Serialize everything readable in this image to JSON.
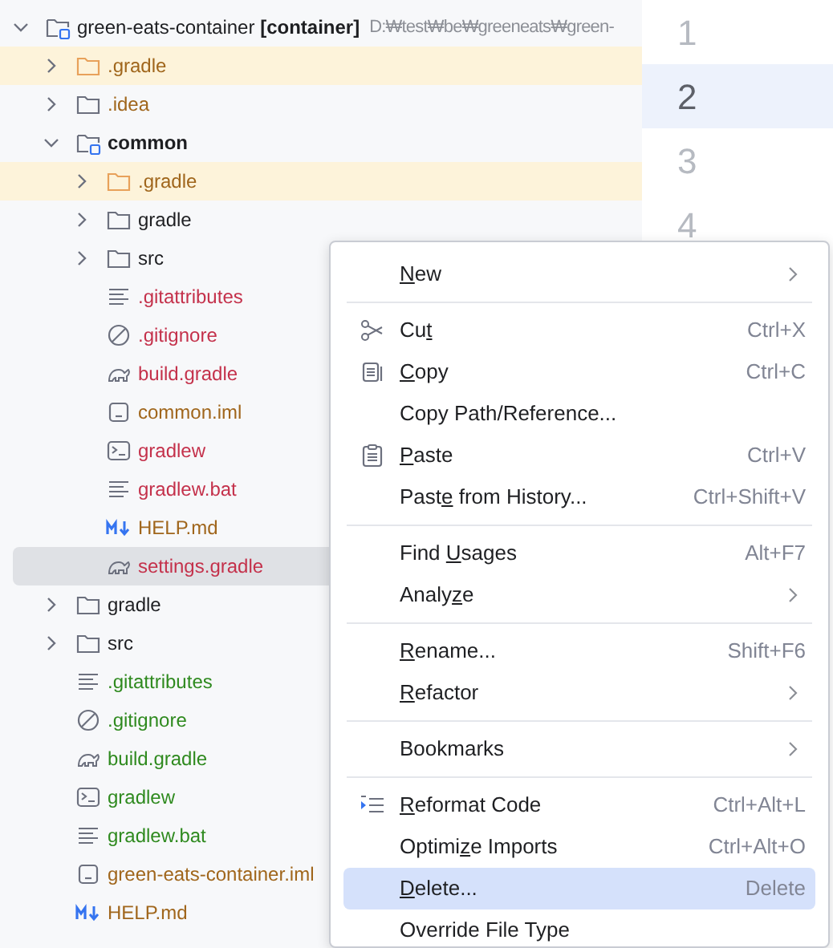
{
  "project_tree": [
    {
      "label": "green-eats-container **[container]**",
      "path": "D:₩test₩be₩greeneats₩green-",
      "kind": "module",
      "expanded": true,
      "bold": false,
      "color": "#1e1f22",
      "highlighted": false,
      "selected": false,
      "children": [
        {
          "label": ".gradle",
          "kind": "folder",
          "expanded": false,
          "bold": false,
          "color": "#a0661c",
          "highlighted": true,
          "selected": false
        },
        {
          "label": ".idea",
          "kind": "folder",
          "expanded": false,
          "bold": false,
          "color": "#a0661c",
          "highlighted": false,
          "selected": false
        },
        {
          "label": "common",
          "kind": "module",
          "expanded": true,
          "bold": true,
          "color": "#1e1f22",
          "highlighted": false,
          "selected": false,
          "children": [
            {
              "label": ".gradle",
              "kind": "folder",
              "expanded": false,
              "bold": false,
              "color": "#a0661c",
              "highlighted": true,
              "selected": false
            },
            {
              "label": "gradle",
              "kind": "folder",
              "expanded": false,
              "bold": false,
              "color": "#1e1f22",
              "highlighted": false,
              "selected": false
            },
            {
              "label": "src",
              "kind": "folder",
              "expanded": false,
              "bold": false,
              "color": "#1e1f22",
              "highlighted": false,
              "selected": false
            },
            {
              "label": ".gitattributes",
              "kind": "text",
              "bold": false,
              "color": "#c4314b",
              "highlighted": false,
              "selected": false
            },
            {
              "label": ".gitignore",
              "kind": "ignore",
              "bold": false,
              "color": "#c4314b",
              "highlighted": false,
              "selected": false
            },
            {
              "label": "build.gradle",
              "kind": "gradle",
              "bold": false,
              "color": "#c4314b",
              "highlighted": false,
              "selected": false
            },
            {
              "label": "common.iml",
              "kind": "iml",
              "bold": false,
              "color": "#a0661c",
              "highlighted": false,
              "selected": false
            },
            {
              "label": "gradlew",
              "kind": "shell",
              "bold": false,
              "color": "#c4314b",
              "highlighted": false,
              "selected": false
            },
            {
              "label": "gradlew.bat",
              "kind": "text",
              "bold": false,
              "color": "#c4314b",
              "highlighted": false,
              "selected": false
            },
            {
              "label": "HELP.md",
              "kind": "markdown",
              "bold": false,
              "color": "#a0661c",
              "highlighted": false,
              "selected": false
            },
            {
              "label": "settings.gradle",
              "kind": "gradle",
              "bold": false,
              "color": "#c4314b",
              "highlighted": false,
              "selected": true
            }
          ]
        },
        {
          "label": "gradle",
          "kind": "folder",
          "expanded": false,
          "bold": false,
          "color": "#1e1f22",
          "highlighted": false,
          "selected": false
        },
        {
          "label": "src",
          "kind": "folder",
          "expanded": false,
          "bold": false,
          "color": "#1e1f22",
          "highlighted": false,
          "selected": false
        },
        {
          "label": ".gitattributes",
          "kind": "text",
          "bold": false,
          "color": "#2f8a1f",
          "highlighted": false,
          "selected": false
        },
        {
          "label": ".gitignore",
          "kind": "ignore",
          "bold": false,
          "color": "#2f8a1f",
          "highlighted": false,
          "selected": false
        },
        {
          "label": "build.gradle",
          "kind": "gradle",
          "bold": false,
          "color": "#2f8a1f",
          "highlighted": false,
          "selected": false
        },
        {
          "label": "gradlew",
          "kind": "shell",
          "bold": false,
          "color": "#2f8a1f",
          "highlighted": false,
          "selected": false
        },
        {
          "label": "gradlew.bat",
          "kind": "text",
          "bold": false,
          "color": "#2f8a1f",
          "highlighted": false,
          "selected": false
        },
        {
          "label": "green-eats-container.iml",
          "kind": "iml",
          "bold": false,
          "color": "#a0661c",
          "highlighted": false,
          "selected": false
        },
        {
          "label": "HELP.md",
          "kind": "markdown",
          "bold": false,
          "color": "#a0661c",
          "highlighted": false,
          "selected": false
        }
      ]
    }
  ],
  "editor": {
    "line_numbers": [
      {
        "number": "1",
        "current": false
      },
      {
        "number": "2",
        "current": true
      },
      {
        "number": "3",
        "current": false
      },
      {
        "number": "4",
        "current": false
      }
    ]
  },
  "context_menu": [
    {
      "kind": "item",
      "mnemonic": "N",
      "text_after": "ew",
      "submenu": true,
      "selected": false
    },
    {
      "kind": "separator"
    },
    {
      "kind": "cut",
      "text_before": "Cu",
      "mnemonic": "t",
      "shortcut": "Ctrl+X",
      "submenu": false,
      "selected": false
    },
    {
      "kind": "copy",
      "mnemonic": "C",
      "text_after": "opy",
      "shortcut": "Ctrl+C",
      "submenu": false,
      "selected": false
    },
    {
      "kind": "item",
      "text_before": "Copy Path/Reference...",
      "submenu": false,
      "selected": false
    },
    {
      "kind": "paste",
      "mnemonic": "P",
      "text_after": "aste",
      "shortcut": "Ctrl+V",
      "submenu": false,
      "selected": false
    },
    {
      "kind": "item",
      "text_before": "Past",
      "mnemonic": "e",
      "text_after": " from History...",
      "shortcut": "Ctrl+Shift+V",
      "submenu": false,
      "selected": false
    },
    {
      "kind": "separator"
    },
    {
      "kind": "item",
      "text_before": "Find ",
      "mnemonic": "U",
      "text_after": "sages",
      "shortcut": "Alt+F7",
      "submenu": false,
      "selected": false
    },
    {
      "kind": "item",
      "text_before": "Analy",
      "mnemonic": "z",
      "text_after": "e",
      "submenu": true,
      "selected": false
    },
    {
      "kind": "separator"
    },
    {
      "kind": "item",
      "mnemonic": "R",
      "text_after": "ename...",
      "shortcut": "Shift+F6",
      "submenu": false,
      "selected": false
    },
    {
      "kind": "item",
      "mnemonic": "R",
      "text_after": "efactor",
      "submenu": true,
      "selected": false
    },
    {
      "kind": "separator"
    },
    {
      "kind": "item",
      "text_before": "Bookmarks",
      "submenu": true,
      "selected": false
    },
    {
      "kind": "separator"
    },
    {
      "kind": "reformat",
      "mnemonic": "R",
      "text_after": "eformat Code",
      "shortcut": "Ctrl+Alt+L",
      "submenu": false,
      "selected": false
    },
    {
      "kind": "item",
      "text_before": "Optimi",
      "mnemonic": "z",
      "text_after": "e Imports",
      "shortcut": "Ctrl+Alt+O",
      "submenu": false,
      "selected": false
    },
    {
      "kind": "item",
      "mnemonic": "D",
      "text_after": "elete...",
      "shortcut": "Delete",
      "submenu": false,
      "selected": true
    },
    {
      "kind": "item",
      "text_before": "Override File Type",
      "submenu": false,
      "selected": false
    }
  ]
}
